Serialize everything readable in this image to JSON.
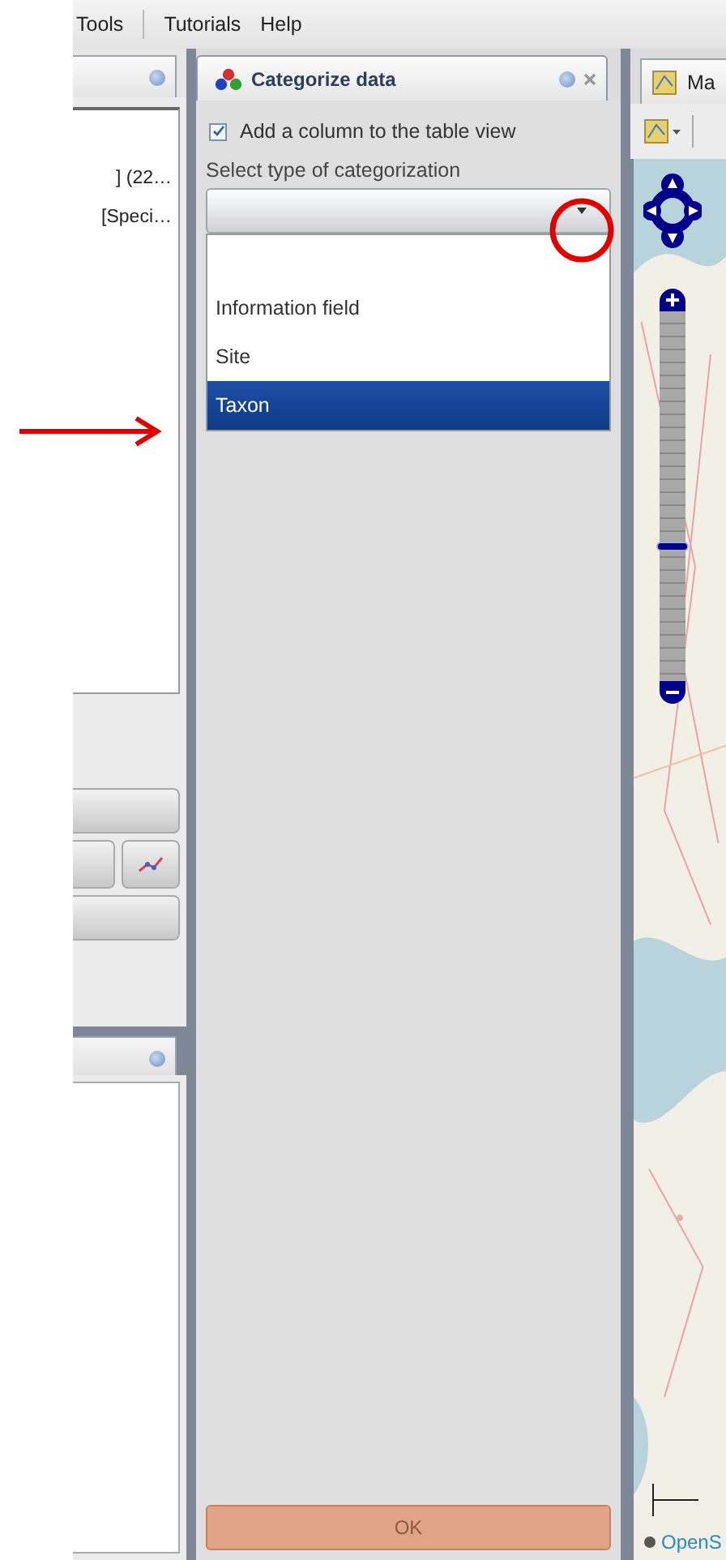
{
  "menu": [
    "Tools",
    "Tutorials",
    "Help"
  ],
  "left_panel": {
    "rows": [
      "] (22…",
      "[Speci…"
    ]
  },
  "categorize_panel": {
    "title": "Categorize data",
    "add_column": {
      "label": "Add a column to the table view",
      "checked": true
    },
    "select_label": "Select type of categorization",
    "options": [
      {
        "label": "Information field",
        "selected": false
      },
      {
        "label": "Site",
        "selected": false
      },
      {
        "label": "Taxon",
        "selected": true
      }
    ],
    "ok_button": {
      "label": "OK",
      "disabled": true
    }
  },
  "map_panel": {
    "tab": "Ma",
    "zoom": {
      "level": 0.35
    },
    "attribution": "OpenS"
  }
}
